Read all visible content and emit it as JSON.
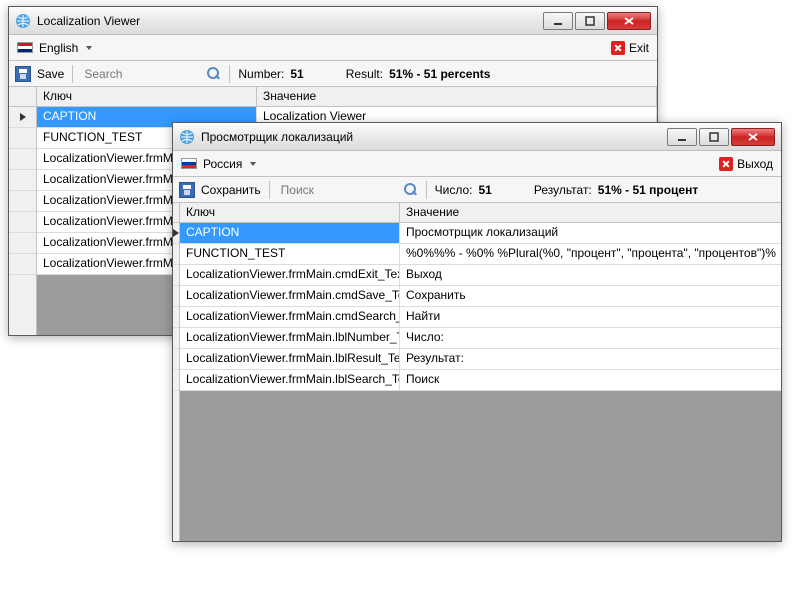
{
  "en": {
    "title": "Localization Viewer",
    "lang_label": "English",
    "exit_label": "Exit",
    "save_label": "Save",
    "search_placeholder": "Search",
    "number_label": "Number:",
    "number_value": "51",
    "result_label": "Result:",
    "result_value": "51% - 51 percents",
    "col_key": "Ключ",
    "col_val": "Значение",
    "rows": [
      {
        "key": "CAPTION",
        "val": "Localization Viewer"
      },
      {
        "key": "FUNCTION_TEST",
        "val": ""
      },
      {
        "key": "LocalizationViewer.frmMain",
        "val": ""
      },
      {
        "key": "LocalizationViewer.frmMain",
        "val": ""
      },
      {
        "key": "LocalizationViewer.frmMain",
        "val": ""
      },
      {
        "key": "LocalizationViewer.frmMain",
        "val": ""
      },
      {
        "key": "LocalizationViewer.frmMain",
        "val": ""
      },
      {
        "key": "LocalizationViewer.frmMain",
        "val": ""
      }
    ]
  },
  "ru": {
    "title": "Просмотрщик локализаций",
    "lang_label": "Россия",
    "exit_label": "Выход",
    "save_label": "Сохранить",
    "search_placeholder": "Поиск",
    "number_label": "Число:",
    "number_value": "51",
    "result_label": "Результат:",
    "result_value": "51% - 51 процент",
    "col_key": "Ключ",
    "col_val": "Значение",
    "rows": [
      {
        "key": "CAPTION",
        "val": "Просмотрщик локализаций"
      },
      {
        "key": "FUNCTION_TEST",
        "val": "%0%%% - %0% %Plural(%0, \"процент\", \"процента\", \"процентов\")%"
      },
      {
        "key": "LocalizationViewer.frmMain.cmdExit_Text",
        "val": "Выход"
      },
      {
        "key": "LocalizationViewer.frmMain.cmdSave_Text",
        "val": "Сохранить"
      },
      {
        "key": "LocalizationViewer.frmMain.cmdSearch_Text",
        "val": "Найти"
      },
      {
        "key": "LocalizationViewer.frmMain.lblNumber_Text",
        "val": "Число:"
      },
      {
        "key": "LocalizationViewer.frmMain.lblResult_Text",
        "val": "Результат:"
      },
      {
        "key": "LocalizationViewer.frmMain.lblSearch_Text",
        "val": "Поиск"
      }
    ]
  }
}
